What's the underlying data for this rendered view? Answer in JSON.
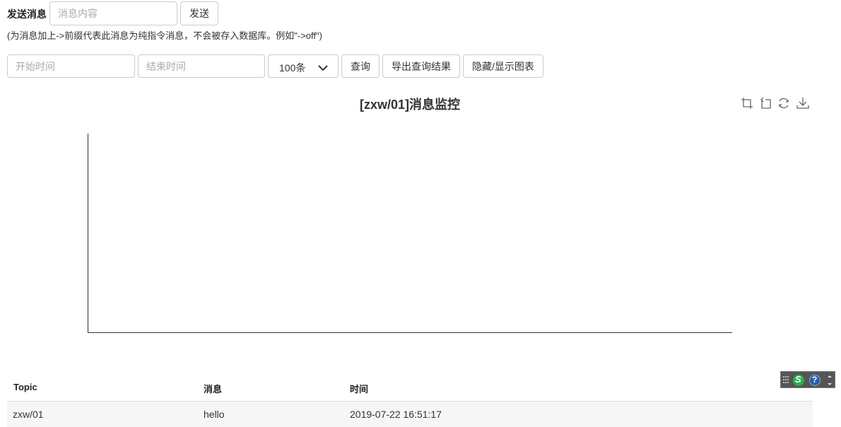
{
  "send": {
    "label": "发送消息",
    "input_placeholder": "消息内容",
    "input_value": "",
    "button_label": "发送"
  },
  "hint": "(为消息加上->前缀代表此消息为纯指令消息，不会被存入数据库。例如\"->off\")",
  "query": {
    "start_placeholder": "开始时间",
    "end_placeholder": "结束时间",
    "limit_selected": "100条",
    "query_button": "查询",
    "export_button": "导出查询结果",
    "toggle_chart_button": "隐藏/显示图表"
  },
  "chart": {
    "title": "[zxw/01]消息监控",
    "toolbox": [
      "zoom-icon",
      "zoom-reset-icon",
      "refresh-icon",
      "download-icon"
    ]
  },
  "chart_data": {
    "type": "line",
    "title": "[zxw/01]消息监控",
    "xlabel": "",
    "ylabel": "",
    "series": [],
    "grid": false
  },
  "table": {
    "headers": [
      "Topic",
      "消息",
      "时间"
    ],
    "rows": [
      [
        "zxw/01",
        "hello",
        "2019-07-22 16:51:17"
      ]
    ]
  },
  "widget": {
    "letter": "S",
    "help": "?"
  },
  "colors": {
    "border": "#cccccc",
    "row_bg": "#f6f6f6",
    "widget_bg": "#555555",
    "widget_green": "#2bb24c"
  }
}
